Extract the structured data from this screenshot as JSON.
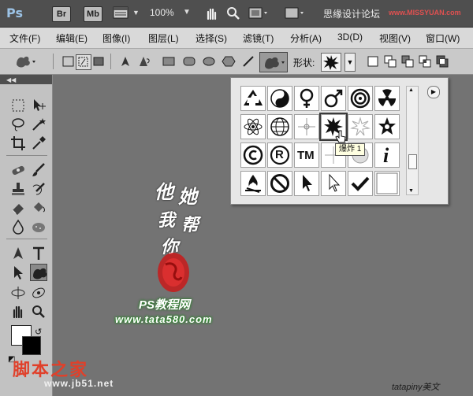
{
  "app": {
    "logo": "Ps",
    "bridge_label": "Br",
    "minibridge_label": "Mb",
    "zoom": "100%",
    "site_title": "思缘设计论坛",
    "site_url": "www.MISSYUAN.com"
  },
  "menu": {
    "items": [
      "文件(F)",
      "编辑(E)",
      "图像(I)",
      "图层(L)",
      "选择(S)",
      "滤镜(T)",
      "分析(A)",
      "3D(D)",
      "视图(V)",
      "窗口(W)"
    ]
  },
  "options": {
    "shape_label": "形状:",
    "icons": [
      "add-shape-layer-icon",
      "add-paths-icon",
      "fill-pixels-icon",
      "pen-icon",
      "freeform-pen-icon",
      "rectangle-icon",
      "rounded-rectangle-icon",
      "ellipse-icon",
      "polygon-icon",
      "line-icon",
      "custom-shape-icon"
    ]
  },
  "picker": {
    "shapes": [
      [
        "recycle-icon",
        "yin-yang-icon",
        "female-sign-icon",
        "male-sign-icon",
        "target-icon",
        "radiation-icon"
      ],
      [
        "atom-icon",
        "globe-icon",
        "spark-icon",
        "explosion-icon",
        "burst-faint-icon",
        "star-badge-icon"
      ],
      [
        "copyright-icon",
        "registered-icon",
        "trademark-icon",
        "crosshair-icon",
        "halftone-icon",
        "info-icon"
      ],
      [
        "fire-icon",
        "no-sign-icon",
        "cursor-arrow-icon",
        "cursor-outline-icon",
        "checkmark-icon",
        "blank-shape-icon"
      ]
    ],
    "trademark_text": "TM",
    "registered_text": "R",
    "info_text": "i",
    "tooltip": "爆炸 1",
    "scroll_up": "▲",
    "scroll_down": "▼",
    "menu_glyph": "▶"
  },
  "canvas": {
    "calligraphy_chars": [
      "他",
      "她",
      "我",
      "帮",
      "你"
    ],
    "ps_caption": "PS教程网",
    "site_caption": "www.tata580.com"
  },
  "footer": {
    "jb_logo": "脚本之家",
    "jb_url": "www.jb51.net",
    "watermark": "tatapiny美文"
  },
  "colors": {
    "accent_red": "#cc1e1e",
    "glow_green": "#2a7d2a",
    "panel_bg": "#c2c2c2",
    "canvas_bg": "#737373"
  }
}
